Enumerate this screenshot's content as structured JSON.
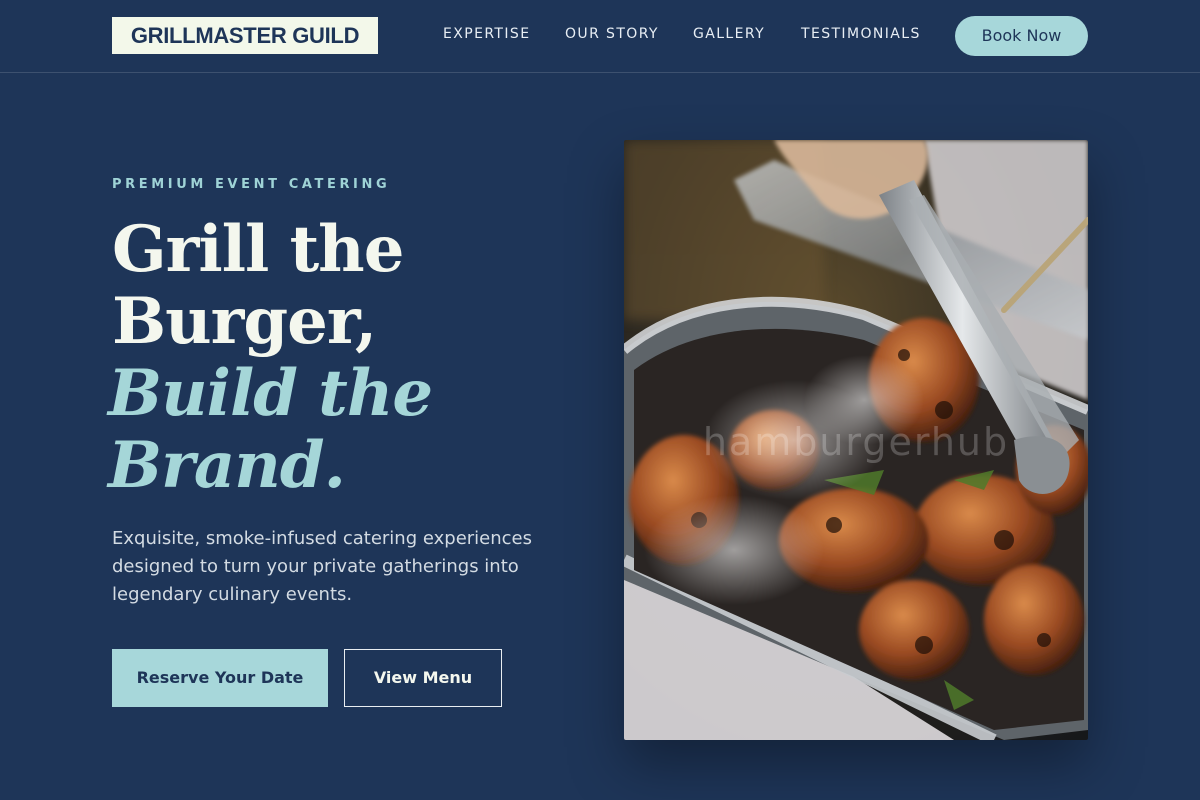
{
  "header": {
    "logo": "GRILLMASTER GUILD",
    "nav": [
      "EXPERTISE",
      "OUR STORY",
      "GALLERY",
      "TESTIMONIALS"
    ],
    "cta": "Book Now"
  },
  "hero": {
    "eyebrow": "PREMIUM EVENT CATERING",
    "headline_lines": [
      "Grill the",
      "Burger,"
    ],
    "headline_accent_lines": [
      "Build the",
      "Brand."
    ],
    "subtext": "Exquisite, smoke-infused catering experiences designed to turn your private gatherings into legendary culinary events.",
    "primary_button": "Reserve Your Date",
    "secondary_button": "View Menu",
    "image": {
      "subject": "tongs lifting grilled meat from a steaming tray",
      "watermark": "hamburgerhub"
    }
  },
  "colors": {
    "background": "#1e3558",
    "accent": "#a7d7da",
    "text": "#f4f7ee"
  }
}
